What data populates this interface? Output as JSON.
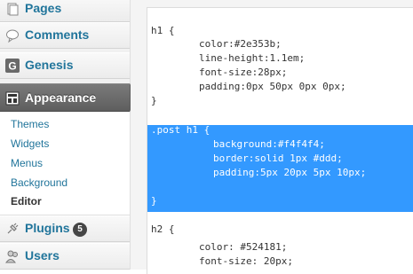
{
  "sidebar": {
    "pages_label": "Pages",
    "comments_label": "Comments",
    "genesis_label": "Genesis",
    "appearance_label": "Appearance",
    "submenu": [
      "Themes",
      "Widgets",
      "Menus",
      "Background",
      "Editor"
    ],
    "current_submenu": "Editor",
    "plugins_label": "Plugins",
    "plugins_badge": "5",
    "users_label": "Users"
  },
  "colors": {
    "link": "#21759b",
    "active_menu": "#6b6b6b",
    "selection": "#3399ff"
  },
  "editor": {
    "lines": [
      {
        "text": "h1 {",
        "selected": false
      },
      {
        "text": "color:#2e353b;",
        "selected": false
      },
      {
        "text": "line-height:1.1em;",
        "selected": false
      },
      {
        "text": "font-size:28px;",
        "selected": false
      },
      {
        "text": "padding:0px 50px 0px 0px;",
        "selected": false
      },
      {
        "text": "}",
        "selected": false
      },
      {
        "text": "",
        "selected": false
      },
      {
        "text": ".post h1 {",
        "selected": true
      },
      {
        "text": "background:#f4f4f4;",
        "selected": true
      },
      {
        "text": "border:solid 1px #ddd;",
        "selected": true
      },
      {
        "text": "padding:5px 20px 5px 10px;",
        "selected": true
      },
      {
        "text": "",
        "selected": true
      },
      {
        "text": "}",
        "selected": true
      },
      {
        "text": "",
        "selected": false
      },
      {
        "text": "h2 {",
        "selected": false
      },
      {
        "text": "color: #524181;",
        "selected": false
      },
      {
        "text": "font-size: 20px;",
        "selected": false
      }
    ]
  }
}
